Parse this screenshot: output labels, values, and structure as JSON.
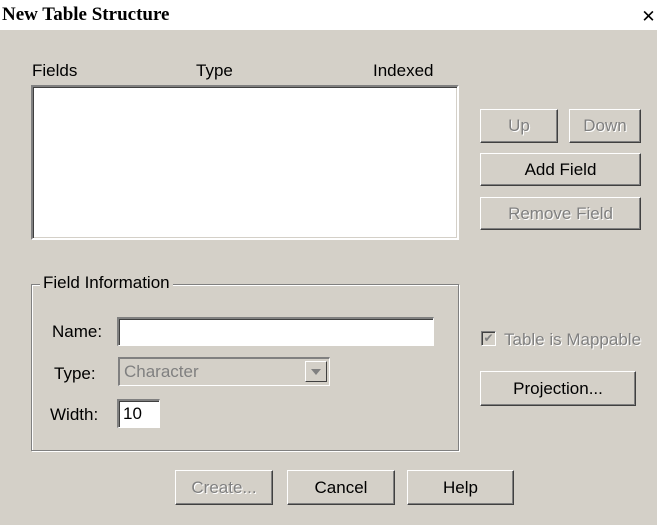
{
  "window": {
    "title": "New Table Structure",
    "close_symbol": "✕"
  },
  "list": {
    "headers": {
      "fields": "Fields",
      "type": "Type",
      "indexed": "Indexed"
    },
    "rows": []
  },
  "buttons": {
    "up": "Up",
    "down": "Down",
    "add_field": "Add Field",
    "remove_field": "Remove Field",
    "projection": "Projection...",
    "create": "Create...",
    "cancel": "Cancel",
    "help": "Help"
  },
  "field_info": {
    "group_title": "Field Information",
    "name_label": "Name:",
    "name_value": "",
    "type_label": "Type:",
    "type_value": "Character",
    "width_label": "Width:",
    "width_value": "10"
  },
  "options": {
    "mappable_label": "Table is Mappable",
    "mappable_checked": true
  },
  "colors": {
    "face": "#d4d0c8",
    "disabled_text": "#808080"
  }
}
